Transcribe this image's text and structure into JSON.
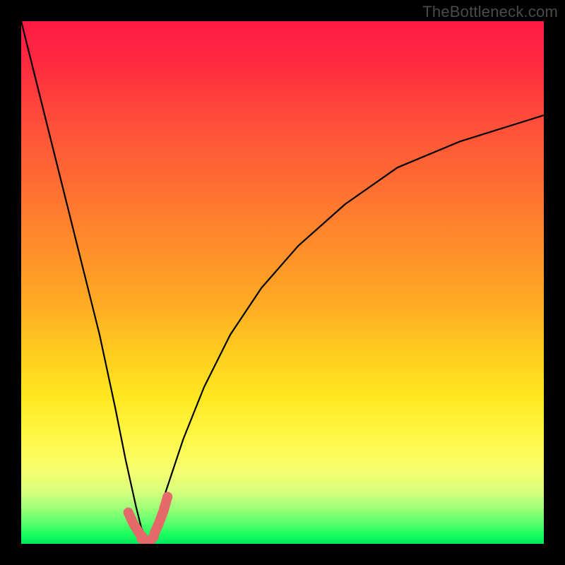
{
  "watermark": "TheBottleneck.com",
  "chart_data": {
    "type": "line",
    "title": "",
    "xlabel": "",
    "ylabel": "",
    "xlim": [
      0,
      100
    ],
    "ylim": [
      0,
      100
    ],
    "grid": false,
    "legend": false,
    "notes": "Black curve on rainbow gradient background. Curve forms a deep 'V' reaching zero near x≈24; left arm climbs to ~100 at x=0, right arm asymptotically rises toward ~82 at x=100. Short salmon/pink highlight segments flank the minimum. Values are estimated from pixel positions (no axis ticks are rendered).",
    "series": [
      {
        "name": "bottleneck-curve",
        "color": "#000000",
        "x": [
          0,
          3,
          6,
          9,
          12,
          15,
          18,
          20,
          22,
          23,
          24,
          25,
          26,
          28,
          31,
          35,
          40,
          46,
          53,
          62,
          72,
          84,
          100
        ],
        "y": [
          100,
          88,
          76,
          64,
          52,
          40,
          26,
          16,
          7,
          3,
          1,
          2,
          5,
          11,
          20,
          30,
          40,
          49,
          57,
          65,
          72,
          77,
          82
        ]
      },
      {
        "name": "highlight-left",
        "color": "#e46a6a",
        "x": [
          20.5,
          21.5,
          22.5,
          23.3
        ],
        "y": [
          6.0,
          3.8,
          2.2,
          1.2
        ]
      },
      {
        "name": "highlight-bottom",
        "color": "#e46a6a",
        "x": [
          23.0,
          23.6,
          24.2,
          24.8,
          25.4
        ],
        "y": [
          1.0,
          0.6,
          0.5,
          0.7,
          1.4
        ]
      },
      {
        "name": "highlight-right",
        "color": "#e46a6a",
        "x": [
          25.5,
          26.3,
          27.2,
          28.0
        ],
        "y": [
          2.0,
          3.8,
          6.2,
          9.0
        ]
      }
    ],
    "gradient_stops": [
      {
        "pos": 0.0,
        "color": "#ff1b45"
      },
      {
        "pos": 0.3,
        "color": "#ff6a33"
      },
      {
        "pos": 0.64,
        "color": "#ffce1f"
      },
      {
        "pos": 0.86,
        "color": "#f6ff6e"
      },
      {
        "pos": 1.0,
        "color": "#00e85e"
      }
    ]
  }
}
